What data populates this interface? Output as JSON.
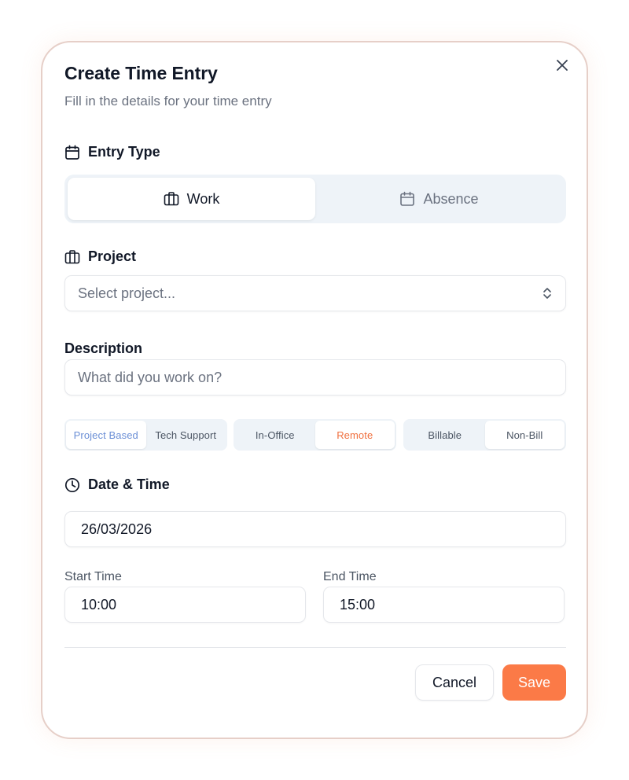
{
  "dialog": {
    "title": "Create Time Entry",
    "subtitle": "Fill in the details for your time entry"
  },
  "entry_type": {
    "label": "Entry Type",
    "options": [
      {
        "label": "Work",
        "icon": "briefcase-icon",
        "selected": true
      },
      {
        "label": "Absence",
        "icon": "calendar-icon",
        "selected": false
      }
    ]
  },
  "project": {
    "label": "Project",
    "placeholder": "Select project..."
  },
  "description": {
    "label": "Description",
    "placeholder": "What did you work on?"
  },
  "toggles": {
    "work_kind": {
      "options": [
        "Project Based",
        "Tech Support"
      ],
      "selected": "Project Based"
    },
    "location": {
      "options": [
        "In-Office",
        "Remote"
      ],
      "selected": "Remote"
    },
    "billing": {
      "options": [
        "Billable",
        "Non-Bill"
      ],
      "selected": "Non-Bill"
    }
  },
  "date_time": {
    "label": "Date & Time",
    "date": "26/03/2026",
    "start_label": "Start Time",
    "start_value": "10:00",
    "end_label": "End Time",
    "end_value": "15:00"
  },
  "actions": {
    "cancel": "Cancel",
    "save": "Save"
  },
  "colors": {
    "accent": "#fb7a47",
    "selected_blue_text": "#6b8fd6",
    "selected_orange_text": "#f0703f",
    "segment_bg": "#eef3f8"
  }
}
